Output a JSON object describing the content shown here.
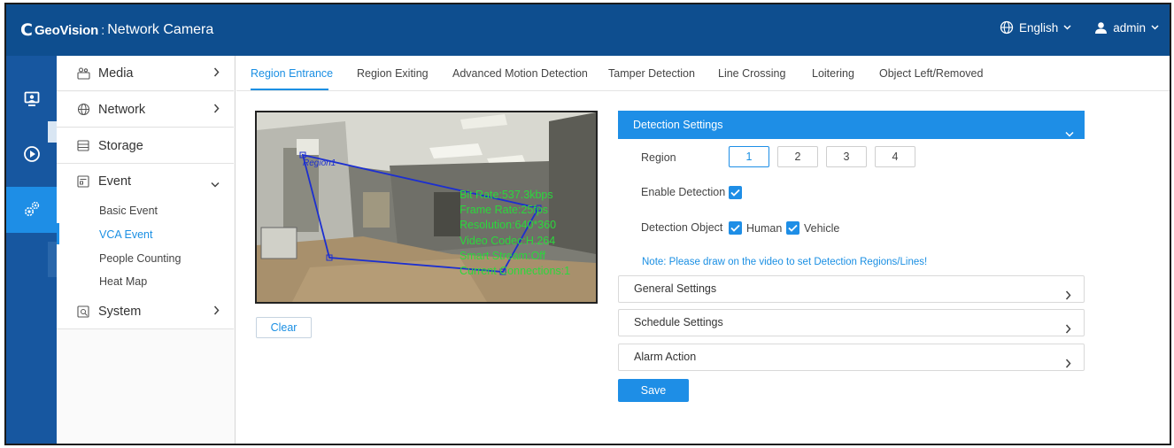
{
  "header": {
    "logo_mark": "C",
    "brand": "GeoVision",
    "separator": ":",
    "product": "Network Camera",
    "language": "English",
    "user": "admin",
    "icons": [
      "globe-icon",
      "chevron-down-icon",
      "user-icon"
    ]
  },
  "rail": {
    "items": [
      "live-view-icon",
      "playback-icon",
      "settings-icon"
    ],
    "active": "settings-icon"
  },
  "sidebar": {
    "items": [
      {
        "label": "Media",
        "icon": "camera-icon"
      },
      {
        "label": "Network",
        "icon": "globe-icon"
      },
      {
        "label": "Storage",
        "icon": "storage-icon"
      },
      {
        "label": "Event",
        "icon": "event-icon"
      },
      {
        "label": "System",
        "icon": "system-icon"
      }
    ],
    "event_subitems": [
      "Basic Event",
      "VCA Event",
      "People Counting",
      "Heat Map"
    ],
    "active_subitem": "VCA Event"
  },
  "tabs": [
    "Region Entrance",
    "Region Exiting",
    "Advanced Motion Detection",
    "Tamper Detection",
    "Line Crossing",
    "Loitering",
    "Object Left/Removed"
  ],
  "active_tab": "Region Entrance",
  "video": {
    "region_label": "Region1",
    "osd": [
      "Bit Rate:537.3kbps",
      "Frame Rate:25fps",
      "Resolution:640*360",
      "Video Codec:H.264",
      "Smart Stream:Off",
      "Current Connections:1"
    ],
    "clear_label": "Clear"
  },
  "detection": {
    "title": "Detection Settings",
    "region_label": "Region",
    "regions": [
      "1",
      "2",
      "3",
      "4"
    ],
    "active_region": "1",
    "enable_label": "Enable Detection",
    "enable_checked": true,
    "object_label": "Detection Object",
    "human_label": "Human",
    "human_checked": true,
    "vehicle_label": "Vehicle",
    "vehicle_checked": true,
    "note": "Note: Please draw on the video to set Detection Regions/Lines!"
  },
  "sections": [
    "General Settings",
    "Schedule Settings",
    "Alarm Action"
  ],
  "save_label": "Save",
  "colors": {
    "header": "#0e4e8f",
    "rail": "#1757a0",
    "accent": "#1e8ee6",
    "osd_text": "#2bd83c",
    "region_line": "#1c2fd0"
  }
}
